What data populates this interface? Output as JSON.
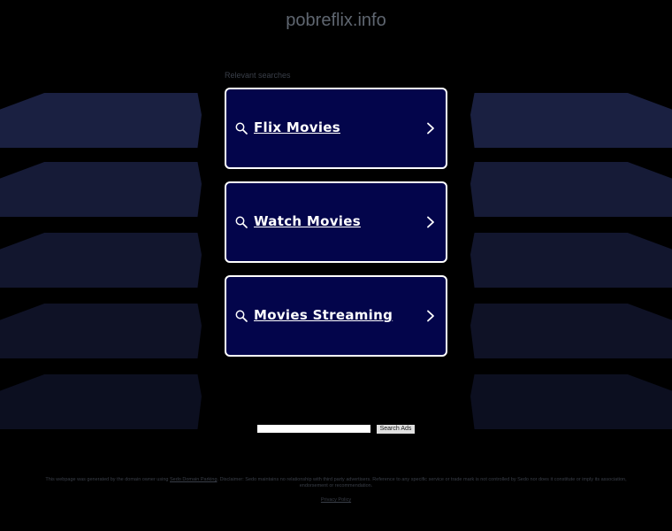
{
  "site": {
    "title": "pobreflix.info"
  },
  "related": {
    "label": "Relevant searches",
    "items": [
      {
        "label": "Flix Movies"
      },
      {
        "label": "Watch Movies"
      },
      {
        "label": "Movies Streaming"
      }
    ]
  },
  "search": {
    "value": "",
    "button_label": "Search Ads"
  },
  "footer": {
    "disclaimer_before": "This webpage was generated by the domain owner using ",
    "disclaimer_link": "Sedo Domain Parking",
    "disclaimer_after": ". Disclaimer: Sedo maintains no relationship with third party advertisers. Reference to any specific service or trade mark is not controlled by Sedo nor does it constitute or imply its association, endorsement or recommendation.",
    "privacy_label": "Privacy Policy"
  },
  "colors": {
    "background": "#000000",
    "box_fill": "#03054b",
    "box_border": "#ffffff",
    "title_text": "#5f6670"
  }
}
